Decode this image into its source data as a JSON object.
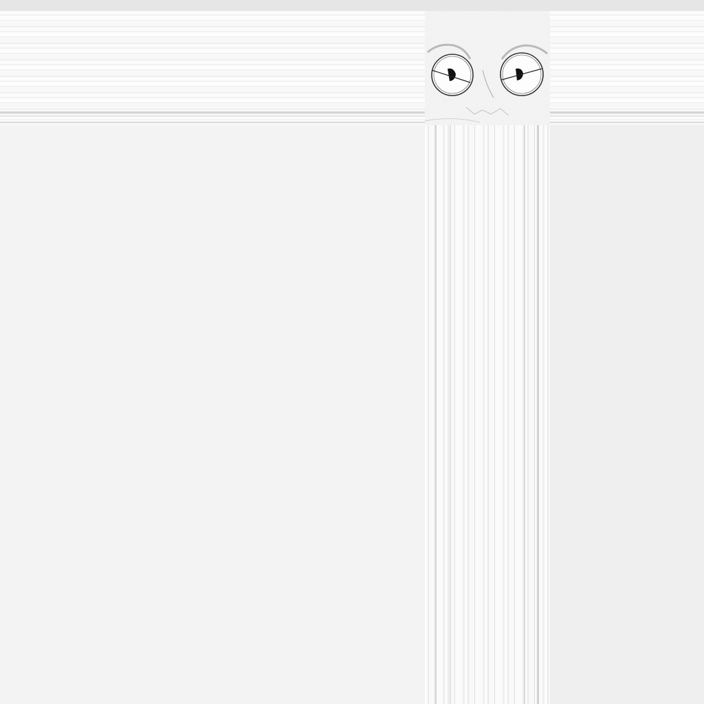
{
  "scene": {
    "description_icon": "sketched-eyes-face-icon",
    "colors": {
      "background": "#f3f3f3",
      "top_bar": "#e6e6e6",
      "right_panel": "#efefef",
      "ink": "#111111"
    }
  }
}
